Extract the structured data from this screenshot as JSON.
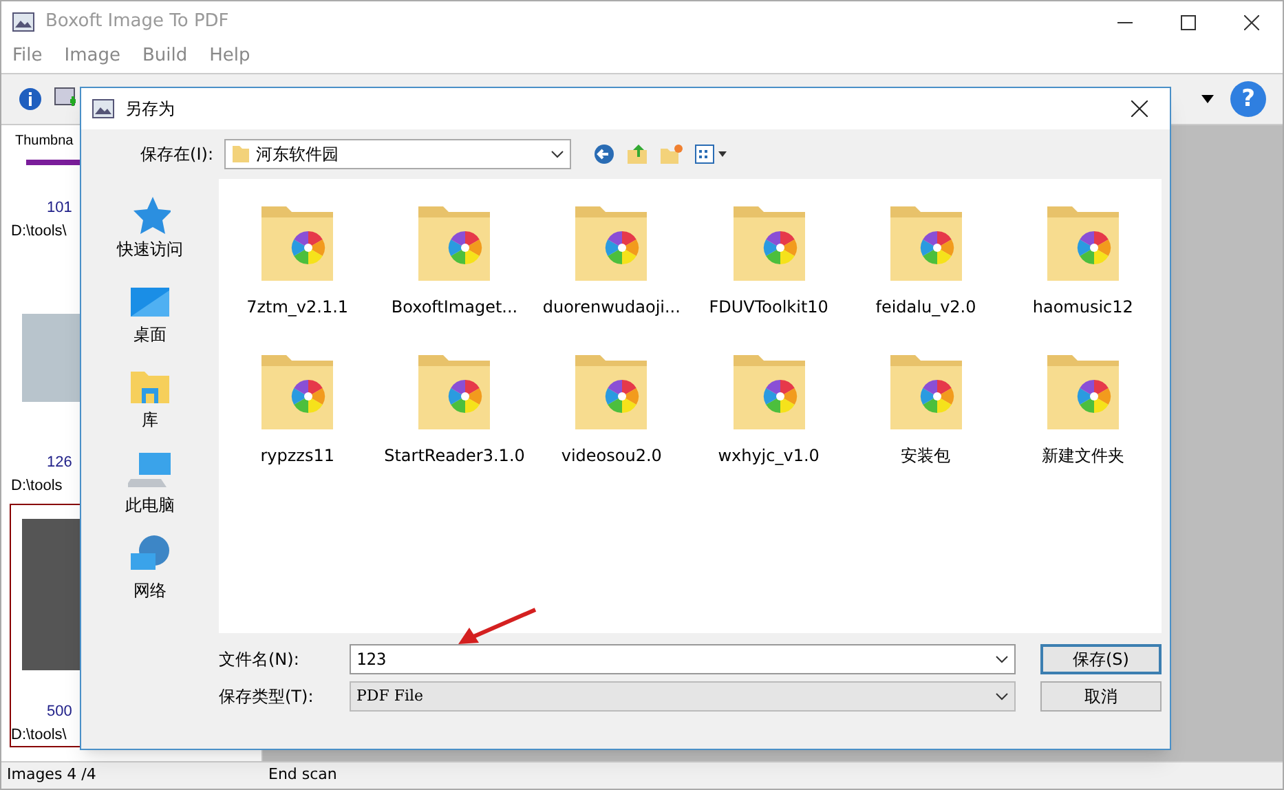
{
  "window": {
    "title": "Boxoft Image To PDF"
  },
  "menu": [
    "File",
    "Image",
    "Build",
    "Help"
  ],
  "thumbnails": {
    "header": "Thumbna",
    "items": [
      {
        "size": "101",
        "path": "D:\\tools\\",
        "selected": false
      },
      {
        "size": "126",
        "path": "D:\\tools",
        "selected": false
      },
      {
        "size": "500",
        "path": "D:\\tools\\",
        "selected": true
      }
    ]
  },
  "help_button": "?",
  "status_bar": [
    "Images 4 /4",
    "End scan"
  ],
  "dialog": {
    "title": "另存为",
    "location_label": "保存在(I):",
    "location": "河东软件园",
    "places": [
      {
        "label": "快速访问",
        "kind": "star"
      },
      {
        "label": "桌面",
        "kind": "desktop"
      },
      {
        "label": "库",
        "kind": "library"
      },
      {
        "label": "此电脑",
        "kind": "computer"
      },
      {
        "label": "网络",
        "kind": "network"
      }
    ],
    "files": [
      "7ztm_v2.1.1",
      "BoxoftImaget...",
      "duorenwudaoji...",
      "FDUVToolkit10",
      "feidalu_v2.0",
      "haomusic12",
      "rypzzs11",
      "StartReader3.1.0",
      "videosou2.0",
      "wxhyjc_v1.0",
      "安装包",
      "新建文件夹"
    ],
    "filename_label": "文件名(N):",
    "filename": "123",
    "filetype_label": "保存类型(T):",
    "filetype": "PDF File",
    "buttons": [
      "保存(S)",
      "取消"
    ]
  }
}
